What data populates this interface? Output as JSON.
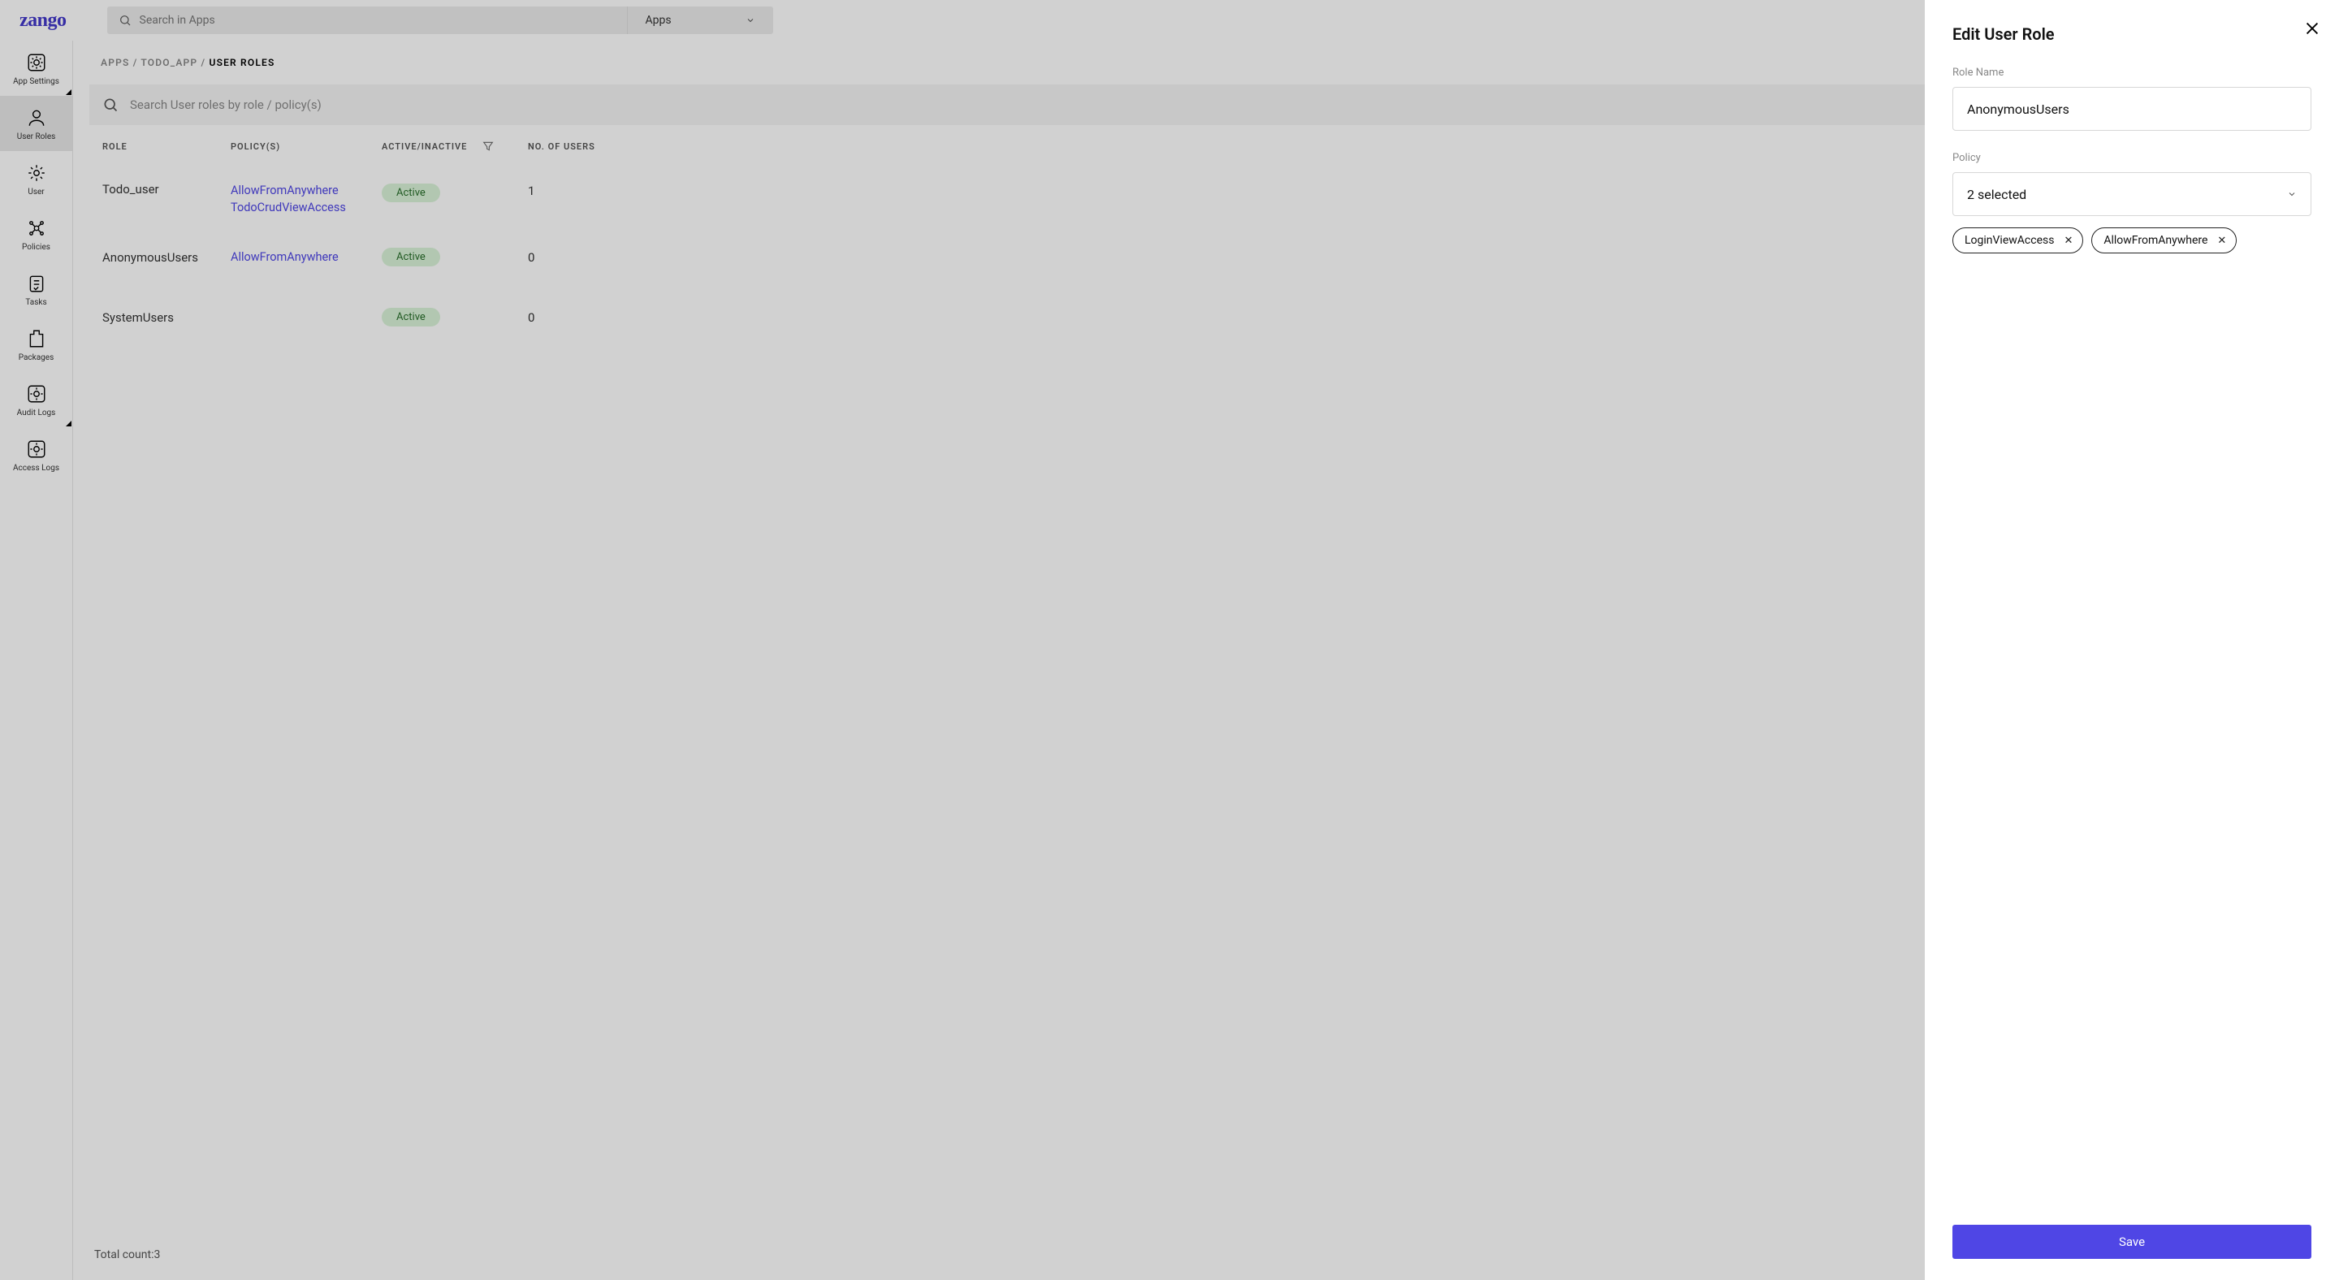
{
  "brand": "zango",
  "search": {
    "placeholder": "Search in Apps",
    "scope_label": "Apps"
  },
  "sidenav": {
    "items": [
      {
        "label": "App Settings"
      },
      {
        "label": "User Roles"
      },
      {
        "label": "User"
      },
      {
        "label": "Policies"
      },
      {
        "label": "Tasks"
      },
      {
        "label": "Packages"
      },
      {
        "label": "Audit Logs"
      },
      {
        "label": "Access Logs"
      }
    ]
  },
  "breadcrumb": {
    "seg1": "APPS",
    "seg2": "TODO_APP",
    "seg3": "USER ROLES",
    "sep": " / "
  },
  "roles_search": {
    "placeholder": "Search User roles by role / policy(s)"
  },
  "table": {
    "headers": {
      "role": "ROLE",
      "policy": "POLICY(S)",
      "status": "ACTIVE/INACTIVE",
      "users": "NO. OF USERS"
    },
    "rows": [
      {
        "role": "Todo_user",
        "policies": [
          "AllowFromAnywhere",
          "TodoCrudViewAccess"
        ],
        "status": "Active",
        "users": "1"
      },
      {
        "role": "AnonymousUsers",
        "policies": [
          "AllowFromAnywhere"
        ],
        "status": "Active",
        "users": "0"
      },
      {
        "role": "SystemUsers",
        "policies": [],
        "status": "Active",
        "users": "0"
      }
    ]
  },
  "footer": {
    "total_label": "Total count: ",
    "total_value": "3"
  },
  "panel": {
    "title": "Edit User Role",
    "role_name_label": "Role Name",
    "role_name_value": "AnonymousUsers",
    "policy_label": "Policy",
    "policy_selected_text": "2 selected",
    "chips": [
      "LoginViewAccess",
      "AllowFromAnywhere"
    ],
    "save_label": "Save"
  }
}
